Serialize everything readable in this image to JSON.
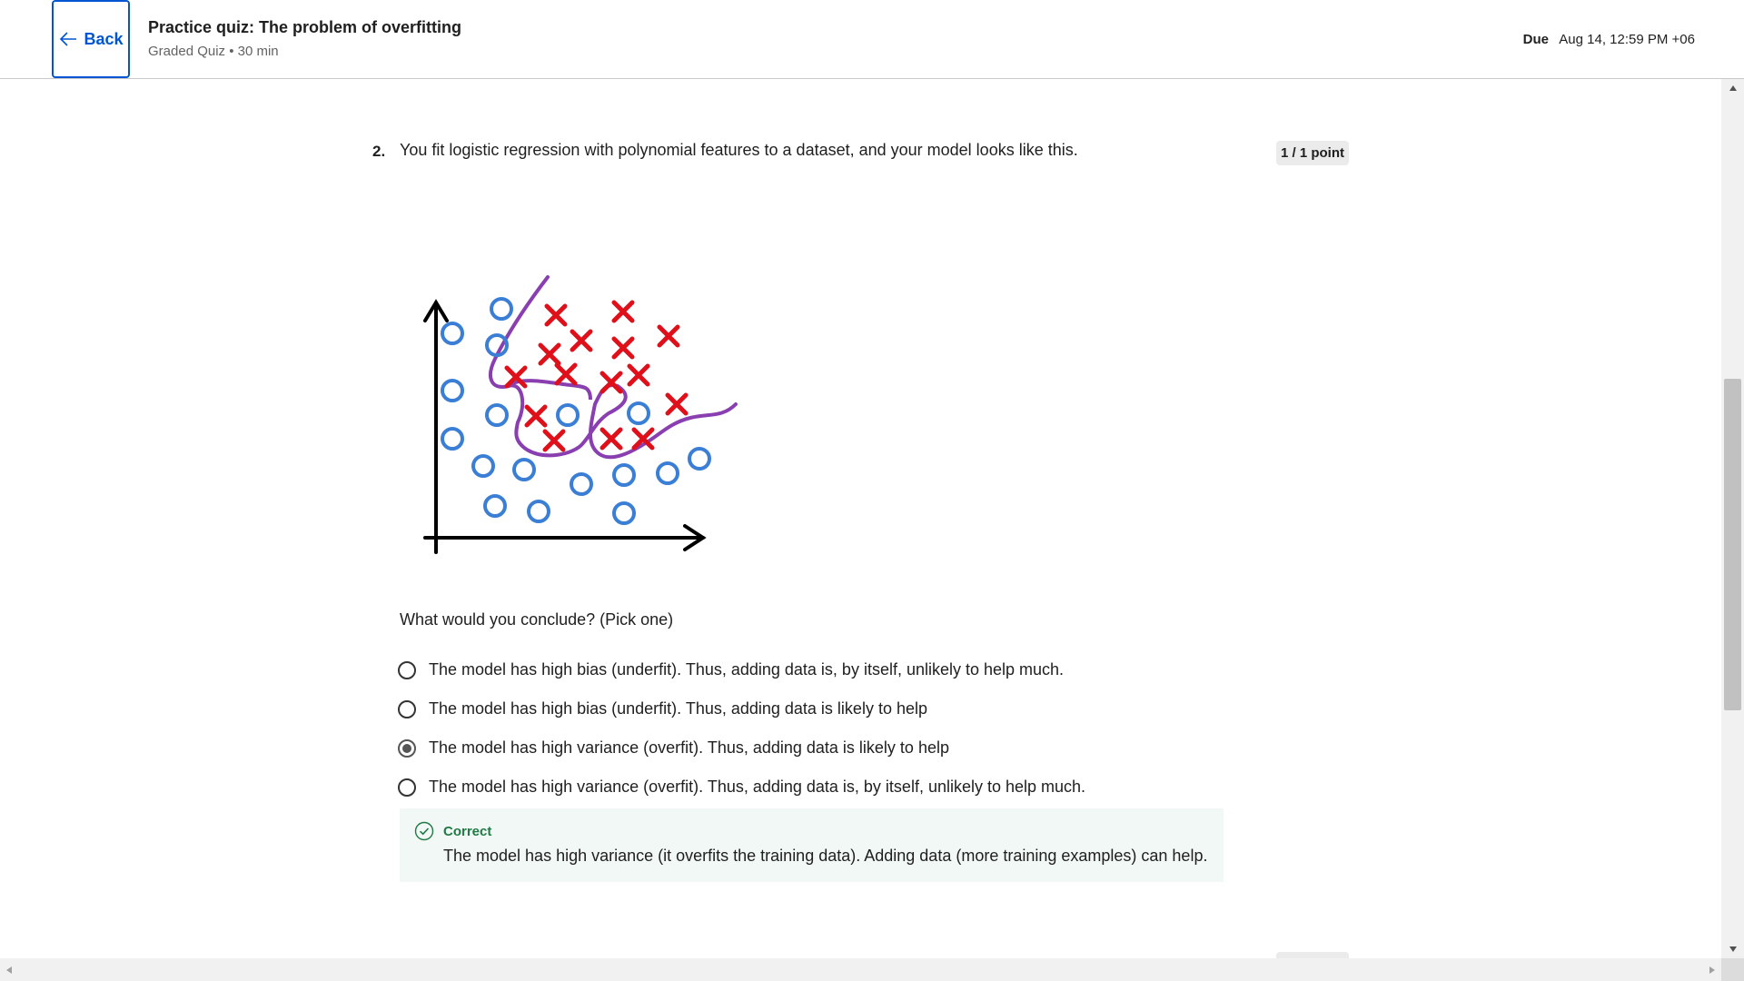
{
  "header": {
    "back_label": "Back",
    "title": "Practice quiz: The problem of overfitting",
    "meta": "Graded Quiz • 30 min",
    "due_label": "Due",
    "due_value": "Aug 14, 12:59 PM +06"
  },
  "question": {
    "number": "2.",
    "text": "You fit logistic regression with polynomial features to a dataset, and your model looks like this.",
    "points": "1 / 1 point",
    "prompt": "What would you conclude? (Pick one)",
    "options": [
      {
        "label": "The model has high bias (underfit). Thus, adding data is, by itself, unlikely to help much.",
        "selected": false
      },
      {
        "label": "The model has high bias (underfit). Thus, adding data is likely to help",
        "selected": false
      },
      {
        "label": "The model has high variance (overfit). Thus, adding data is likely to help",
        "selected": true
      },
      {
        "label": "The model has high variance (overfit). Thus, adding data is, by itself, unlikely to help much.",
        "selected": false
      }
    ],
    "feedback": {
      "status": "Correct",
      "text": "The model has high variance (it overfits the training data). Adding data (more training examples) can help."
    }
  },
  "figure": {
    "icon": "overfit-decision-boundary-plot",
    "colors": {
      "circle": "#3a7fd5",
      "cross": "#e0101a",
      "boundary": "#8a3fb0",
      "axis": "#000000"
    }
  },
  "colors": {
    "accent": "#0056d2",
    "correct": "#1f7a45",
    "feedback_bg": "#f2f8f5"
  }
}
